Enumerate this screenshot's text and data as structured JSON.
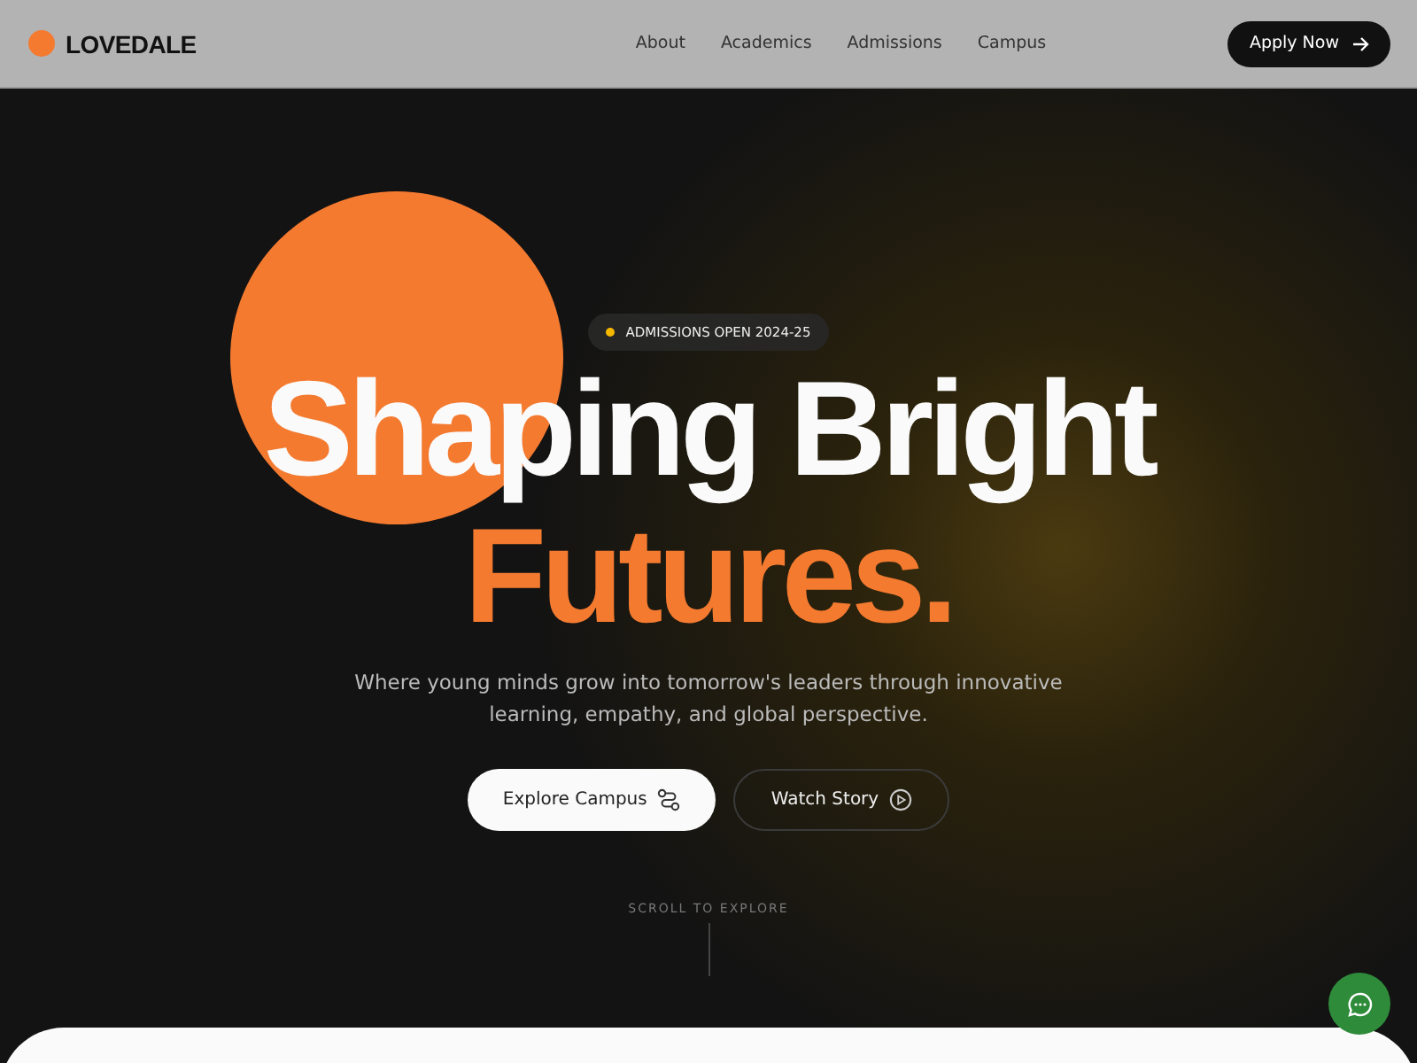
{
  "header": {
    "brand": "LOVEDALE",
    "nav": [
      {
        "label": "About"
      },
      {
        "label": "Academics"
      },
      {
        "label": "Admissions"
      },
      {
        "label": "Campus"
      }
    ],
    "cta": "Apply Now"
  },
  "hero": {
    "badge": {
      "text": "ADMISSIONS OPEN 2024-25",
      "color": "#f5b800"
    },
    "headline": "Shaping Bright",
    "headline_accent": "Futures.",
    "subtitle": "Where young minds grow into tomorrow's leaders through innovative learning, empathy, and global perspective.",
    "buttons": [
      {
        "label": "Explore Campus",
        "kind": "primary"
      },
      {
        "label": "Watch Story",
        "kind": "outline"
      }
    ],
    "scroll_hint": "SCROLL TO EXPLORE"
  }
}
